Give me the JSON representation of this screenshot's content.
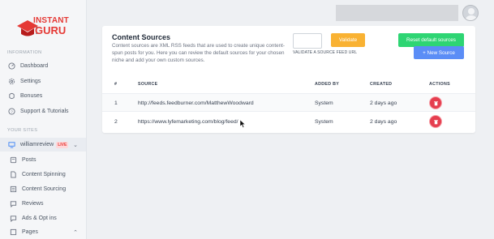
{
  "logo": {
    "line1": "INSTANT",
    "line2": "GURU"
  },
  "sidebar": {
    "information_label": "INFORMATION",
    "info_items": [
      {
        "label": "Dashboard",
        "icon": "dashboard-icon"
      },
      {
        "label": "Settings",
        "icon": "gear-icon"
      },
      {
        "label": "Bonuses",
        "icon": "bonus-icon"
      },
      {
        "label": "Support & Tutorials",
        "icon": "help-icon"
      }
    ],
    "sites_label": "YOUR SITES",
    "site": {
      "name": "williamreview",
      "badge": "LIVE"
    },
    "site_items": [
      {
        "label": "Posts",
        "icon": "posts-icon"
      },
      {
        "label": "Content Spinning",
        "icon": "document-icon"
      },
      {
        "label": "Content Sourcing",
        "icon": "list-icon"
      },
      {
        "label": "Reviews",
        "icon": "chat-icon"
      },
      {
        "label": "Ads & Opt ins",
        "icon": "ads-icon"
      },
      {
        "label": "Pages",
        "icon": "page-icon"
      }
    ]
  },
  "card": {
    "title": "Content Sources",
    "description": "Content sources are XML RSS feeds that are used to create unique content-spun posts for you. Here you can review the default sources for your chosen niche and add your own custom sources.",
    "url_input_placeholder": "",
    "url_label": "VALIDATE A SOURCE FEED URL",
    "validate_label": "Validate",
    "reset_label": "Reset default sources",
    "new_source_label": "+ New Source",
    "columns": [
      "#",
      "SOURCE",
      "ADDED BY",
      "CREATED",
      "ACTIONS"
    ],
    "rows": [
      {
        "num": "1",
        "source": "http://feeds.feedburner.com/MatthewWoodward",
        "added_by": "System",
        "created": "2 days ago"
      },
      {
        "num": "2",
        "source": "https://www.lyfemarketing.com/blog/feed/",
        "added_by": "System",
        "created": "2 days ago"
      }
    ]
  },
  "colors": {
    "brand_red": "#e53935",
    "validate": "#f9b233",
    "reset": "#2ed573",
    "new_source": "#5b8df6",
    "delete": "#e53e4f"
  }
}
